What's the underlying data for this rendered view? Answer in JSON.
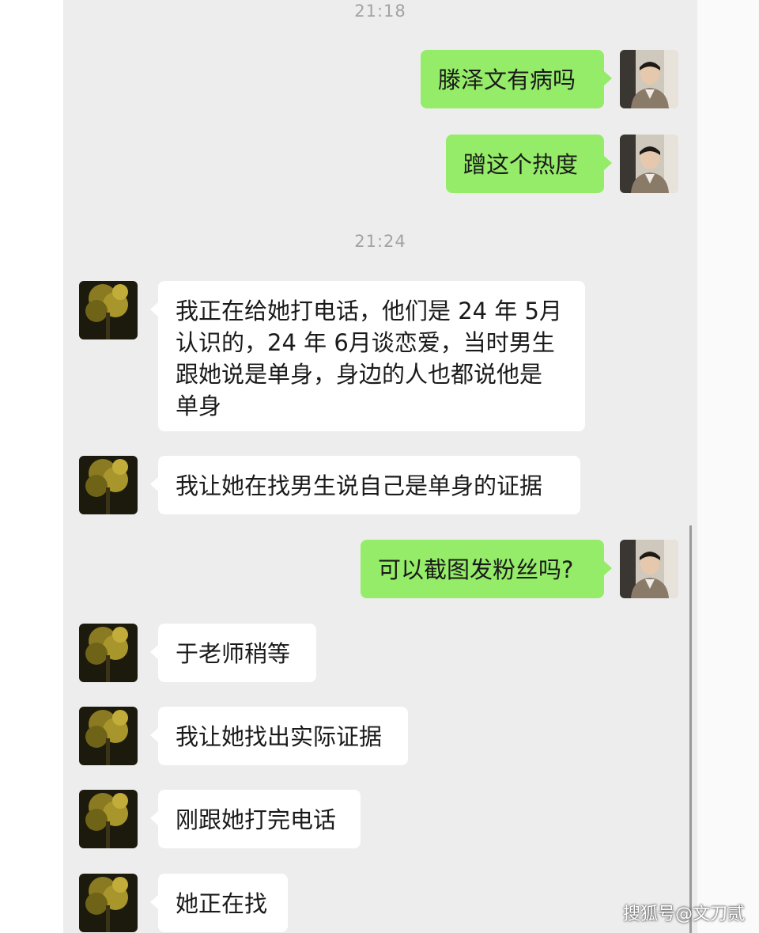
{
  "chat": {
    "timestamps": [
      "21:18",
      "21:24"
    ],
    "messages": [
      {
        "side": "out",
        "text": "滕泽文有病吗"
      },
      {
        "side": "out",
        "text": "蹭这个热度"
      },
      {
        "side": "in",
        "lines": [
          "我正在给她打电话，他们是 24 年 5月",
          "认识的，24 年 6月谈恋爱，当时男生",
          "跟她说是单身，身边的人也都说他是",
          "单身"
        ]
      },
      {
        "side": "in",
        "text": "我让她在找男生说自己是单身的证据"
      },
      {
        "side": "out",
        "text": "可以截图发粉丝吗?"
      },
      {
        "side": "in",
        "text": "于老师稍等"
      },
      {
        "side": "in",
        "text": "我让她找出实际证据"
      },
      {
        "side": "in",
        "text": "刚跟她打完电话"
      },
      {
        "side": "in",
        "text": "她正在找"
      }
    ]
  },
  "watermark": "搜狐号@文刀贰",
  "colors": {
    "outgoing_bubble": "#95ec69",
    "incoming_bubble": "#ffffff",
    "background": "#ededed"
  },
  "icons": {
    "self_avatar": "man-portrait-avatar",
    "contact_avatar": "night-tree-avatar"
  }
}
